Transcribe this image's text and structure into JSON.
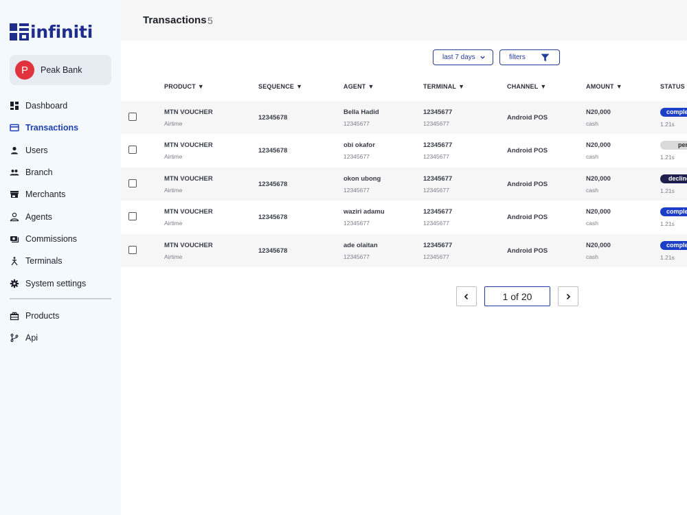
{
  "brand": {
    "name": "infiniti",
    "color": "#1f2d8c"
  },
  "bank": {
    "initial": "P",
    "name": "Peak Bank",
    "avatar_color": "#e0333d"
  },
  "nav": [
    {
      "label": "Dashboard",
      "icon": "dashboard-icon",
      "active": false
    },
    {
      "label": "Transactions",
      "icon": "credit-card-icon",
      "active": true
    },
    {
      "label": "Users",
      "icon": "user-icon",
      "active": false
    },
    {
      "label": "Branch",
      "icon": "group-icon",
      "active": false
    },
    {
      "label": "Merchants",
      "icon": "store-icon",
      "active": false
    },
    {
      "label": "Agents",
      "icon": "agent-icon",
      "active": false
    },
    {
      "label": "Commissions",
      "icon": "money-icon",
      "active": false
    },
    {
      "label": "Terminals",
      "icon": "terminal-icon",
      "active": false
    },
    {
      "label": "System settings",
      "icon": "gear-icon",
      "active": false
    }
  ],
  "nav_secondary": [
    {
      "label": "Products",
      "icon": "products-icon"
    },
    {
      "label": "Api",
      "icon": "api-icon"
    }
  ],
  "header": {
    "title": "Transactions",
    "count": "5"
  },
  "toolbar": {
    "date_range": "last 7 days",
    "filters": "filters"
  },
  "table": {
    "columns": [
      "PRODUCT",
      "SEQUENCE",
      "AGENT",
      "TERMINAL",
      "CHANNEL",
      "AMOUNT",
      "STATUS"
    ],
    "sort_caret": "▼",
    "rows": [
      {
        "product": "MTN VOUCHER",
        "product_type": "Airtime",
        "sequence": "12345678",
        "agent": "Bella Hadid",
        "agent_id": "12345677",
        "terminal": "12345677",
        "terminal_id": "12345677",
        "channel": "Android POS",
        "amount": "N20,000",
        "method": "cash",
        "status": "complete",
        "status_kind": "complete",
        "duration": "1.21s"
      },
      {
        "product": "MTN VOUCHER",
        "product_type": "Airtime",
        "sequence": "12345678",
        "agent": "obi okafor",
        "agent_id": "12345677",
        "terminal": "12345677",
        "terminal_id": "12345677",
        "channel": "Android POS",
        "amount": "N20,000",
        "method": "cash",
        "status": "pending",
        "status_kind": "pending",
        "duration": "1.21s"
      },
      {
        "product": "MTN VOUCHER",
        "product_type": "Airtime",
        "sequence": "12345678",
        "agent": "okon ubong",
        "agent_id": "12345677",
        "terminal": "12345677",
        "terminal_id": "12345677",
        "channel": "Android POS",
        "amount": "N20,000",
        "method": "cash",
        "status": "declined",
        "status_kind": "declined",
        "duration": "1.21s"
      },
      {
        "product": "MTN VOUCHER",
        "product_type": "Airtime",
        "sequence": "12345678",
        "agent": "waziri adamu",
        "agent_id": "12345677",
        "terminal": "12345677",
        "terminal_id": "12345677",
        "channel": "Android POS",
        "amount": "N20,000",
        "method": "cash",
        "status": "complete",
        "status_kind": "complete",
        "duration": "1.21s"
      },
      {
        "product": "MTN VOUCHER",
        "product_type": "Airtime",
        "sequence": "12345678",
        "agent": "ade olaitan",
        "agent_id": "12345677",
        "terminal": "12345677",
        "terminal_id": "12345677",
        "channel": "Android POS",
        "amount": "N20,000",
        "method": "cash",
        "status": "complete",
        "status_kind": "complete",
        "duration": "1.21s"
      }
    ]
  },
  "pagination": {
    "label": "1 of 20"
  }
}
